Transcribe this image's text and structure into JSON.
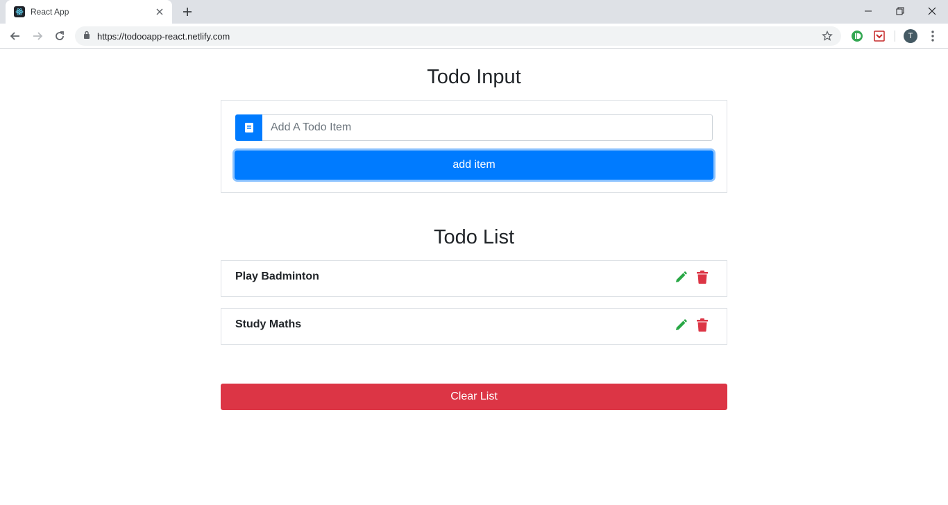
{
  "browser": {
    "tab_title": "React App",
    "url": "https://todooapp-react.netlify.com",
    "profile_initial": "T"
  },
  "input_section": {
    "title": "Todo Input",
    "placeholder": "Add A Todo Item",
    "add_button_label": "add item"
  },
  "list_section": {
    "title": "Todo List",
    "items": [
      {
        "label": "Play Badminton"
      },
      {
        "label": "Study Maths"
      }
    ],
    "clear_button_label": "Clear List"
  },
  "colors": {
    "primary": "#007bff",
    "danger": "#dc3545",
    "success": "#28a745"
  }
}
